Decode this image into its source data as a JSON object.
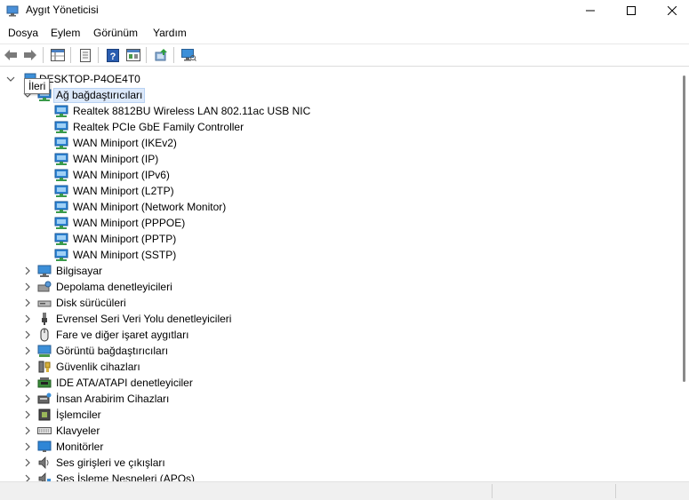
{
  "window": {
    "title": "Aygıt Yöneticisi",
    "controls": [
      "minimize",
      "maximize",
      "close"
    ]
  },
  "menu": {
    "items": [
      "Dosya",
      "Eylem",
      "Görünüm",
      "Yardım"
    ]
  },
  "toolbar": {
    "buttons": [
      "back-icon",
      "forward-icon",
      "properties-grid-icon",
      "document-icon",
      "help-icon",
      "view-icon",
      "update-driver-icon",
      "monitor-scan-icon"
    ]
  },
  "tooltip": {
    "text": "İleri"
  },
  "tree": {
    "root": "DESKTOP-P4OE4T0",
    "expanded_category": "Ağ bağdaştırıcıları",
    "network_adapters": [
      "Realtek 8812BU Wireless LAN 802.11ac USB NIC",
      "Realtek PCIe GbE Family Controller",
      "WAN Miniport (IKEv2)",
      "WAN Miniport (IP)",
      "WAN Miniport (IPv6)",
      "WAN Miniport (L2TP)",
      "WAN Miniport (Network Monitor)",
      "WAN Miniport (PPPOE)",
      "WAN Miniport (PPTP)",
      "WAN Miniport (SSTP)"
    ],
    "categories": [
      {
        "label": "Bilgisayar",
        "icon": "computer-icon"
      },
      {
        "label": "Depolama denetleyicileri",
        "icon": "storage-controller-icon"
      },
      {
        "label": "Disk sürücüleri",
        "icon": "disk-drive-icon"
      },
      {
        "label": "Evrensel Seri Veri Yolu denetleyicileri",
        "icon": "usb-icon"
      },
      {
        "label": "Fare ve diğer işaret aygıtları",
        "icon": "mouse-icon"
      },
      {
        "label": "Görüntü bağdaştırıcıları",
        "icon": "display-adapter-icon"
      },
      {
        "label": "Güvenlik cihazları",
        "icon": "security-device-icon"
      },
      {
        "label": "IDE ATA/ATAPI denetleyiciler",
        "icon": "ide-controller-icon"
      },
      {
        "label": "İnsan Arabirim Cihazları",
        "icon": "hid-icon"
      },
      {
        "label": "İşlemciler",
        "icon": "processor-icon"
      },
      {
        "label": "Klavyeler",
        "icon": "keyboard-icon"
      },
      {
        "label": "Monitörler",
        "icon": "monitor-icon"
      },
      {
        "label": "Ses girişleri ve çıkışları",
        "icon": "speaker-icon"
      },
      {
        "label": "Ses İşleme Nesneleri (APOs)",
        "icon": "audio-processing-icon"
      }
    ]
  },
  "colors": {
    "selection": "#dce9fb",
    "network_icon": "#1e78c8",
    "chevron": "#555555"
  }
}
